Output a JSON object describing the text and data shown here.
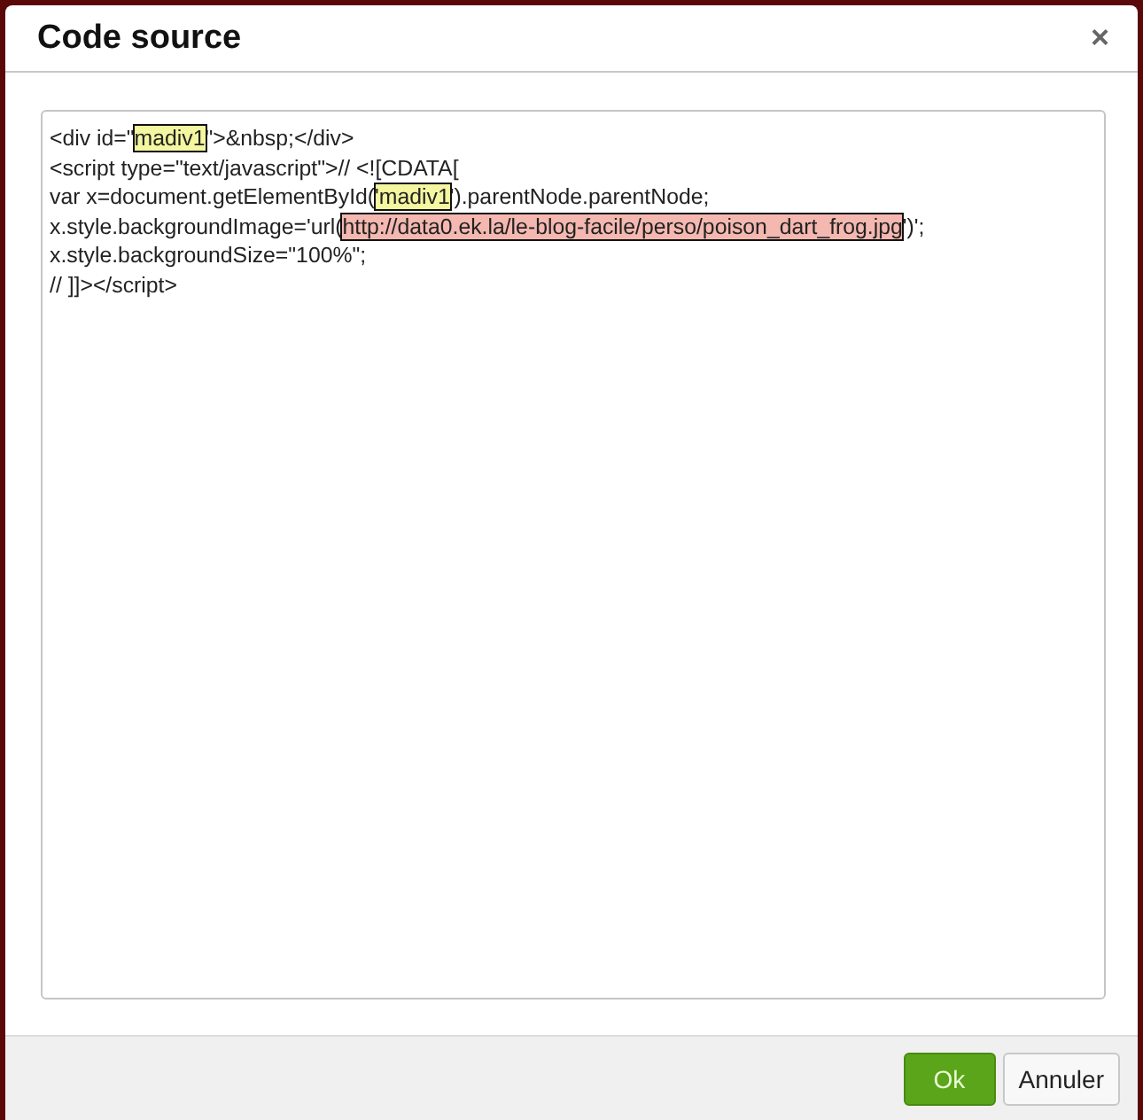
{
  "dialog": {
    "title": "Code source",
    "close": "×"
  },
  "code_lines": [
    [
      {
        "kind": "plain",
        "text": "<div id=\""
      },
      {
        "kind": "match",
        "text": "madiv1"
      },
      {
        "kind": "plain",
        "text": "\">&nbsp;</div>"
      }
    ],
    [
      {
        "kind": "plain",
        "text": "<script type=\"text/javascript\">// <![CDATA["
      }
    ],
    [
      {
        "kind": "plain",
        "text": "var x=document.getElementById("
      },
      {
        "kind": "match",
        "text": "'madiv1"
      },
      {
        "kind": "plain",
        "text": "').parentNode.parentNode;"
      }
    ],
    [
      {
        "kind": "plain",
        "text": "x.style.backgroundImage='url("
      },
      {
        "kind": "url",
        "text": "http://data0.ek.la/le-blog-facile/perso/poison_dart_frog.jpg"
      },
      {
        "kind": "plain",
        "text": "')';"
      }
    ],
    [
      {
        "kind": "plain",
        "text": "x.style.backgroundSize=\"100%\";"
      }
    ],
    [
      {
        "kind": "plain",
        "text": "// ]]></script>"
      }
    ]
  ],
  "buttons": [
    {
      "label": "Ok",
      "kind": "primary"
    },
    {
      "label": "Annuler",
      "kind": "secondary"
    }
  ]
}
